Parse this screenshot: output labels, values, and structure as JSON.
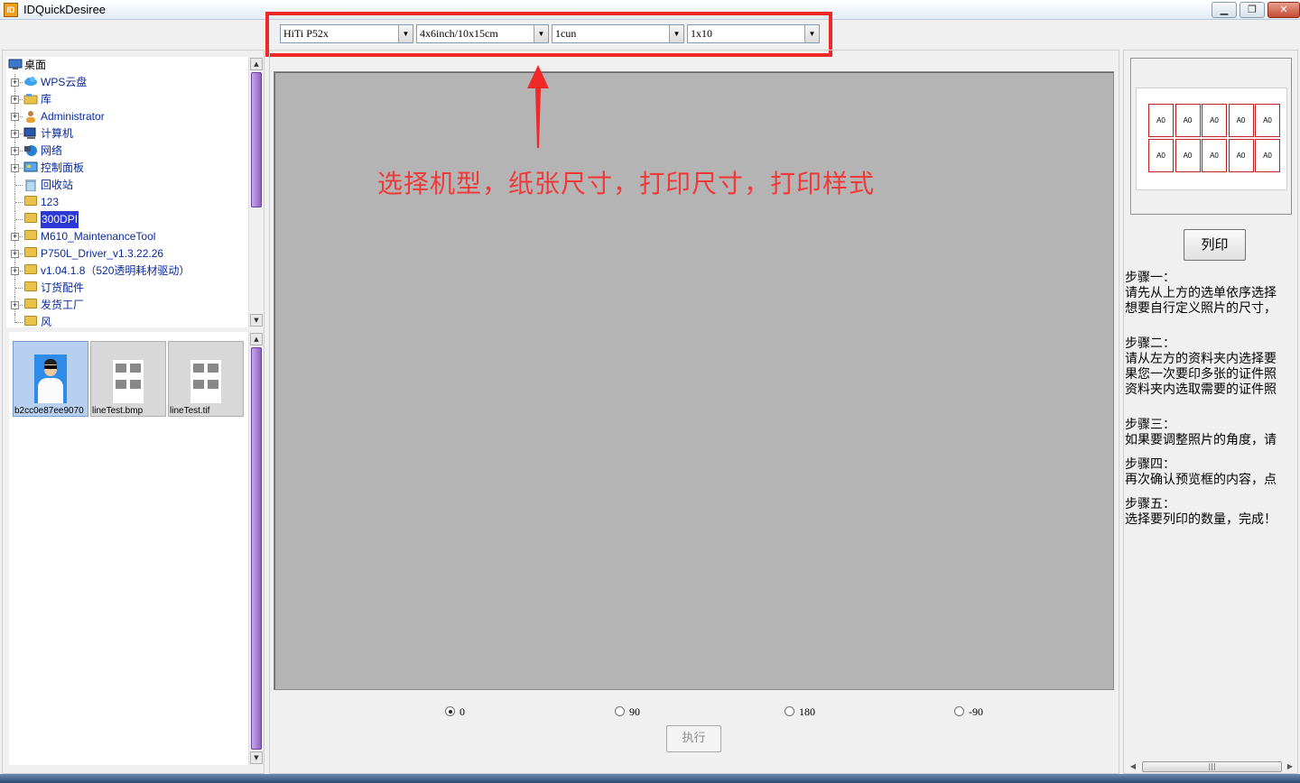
{
  "window": {
    "title": "IDQuickDesiree",
    "icon_text": "ID"
  },
  "toolbar": {
    "printer": "HiTi P52x",
    "paper_size": "4x6inch/10x15cm",
    "print_size": "1cun",
    "print_style": "1x10"
  },
  "annotation": {
    "text": "选择机型，纸张尺寸，打印尺寸，打印样式"
  },
  "tree": {
    "root": "桌面",
    "items": [
      {
        "label": "WPS云盘",
        "expandable": true,
        "icon": "cloud-icon"
      },
      {
        "label": "库",
        "expandable": true,
        "icon": "library-icon"
      },
      {
        "label": "Administrator",
        "expandable": true,
        "icon": "user-icon"
      },
      {
        "label": "计算机",
        "expandable": true,
        "icon": "computer-icon"
      },
      {
        "label": "网络",
        "expandable": true,
        "icon": "network-icon"
      },
      {
        "label": "控制面板",
        "expandable": true,
        "icon": "control-panel-icon"
      },
      {
        "label": "回收站",
        "expandable": false,
        "icon": "recycle-bin-icon"
      },
      {
        "label": "123",
        "expandable": false,
        "icon": "folder-icon"
      },
      {
        "label": "300DPI",
        "expandable": false,
        "icon": "folder-icon",
        "selected": true
      },
      {
        "label": "M610_MaintenanceTool",
        "expandable": true,
        "icon": "folder-icon"
      },
      {
        "label": "P750L_Driver_v1.3.22.26",
        "expandable": true,
        "icon": "folder-icon"
      },
      {
        "label": "v1.04.1.8（520透明耗材驱动）",
        "expandable": true,
        "icon": "folder-icon"
      },
      {
        "label": "订货配件",
        "expandable": false,
        "icon": "folder-icon"
      },
      {
        "label": "发货工厂",
        "expandable": true,
        "icon": "folder-icon"
      },
      {
        "label": "风",
        "expandable": false,
        "icon": "folder-icon"
      }
    ]
  },
  "thumbnails": [
    {
      "caption": "b2cc0e87ee9070",
      "type": "photo",
      "active": true
    },
    {
      "caption": "lineTest.bmp",
      "type": "grid",
      "active": false
    },
    {
      "caption": "lineTest.tif",
      "type": "grid",
      "active": false
    }
  ],
  "rotation": {
    "options": [
      "0",
      "90",
      "180",
      "-90"
    ],
    "selected": "0"
  },
  "execute_label": "执行",
  "layout_preview": {
    "rows": [
      [
        "A0",
        "A0",
        "A0",
        "A0",
        "A0"
      ],
      [
        "A0",
        "A0",
        "A0",
        "A0",
        "A0"
      ]
    ]
  },
  "print_label": "列印",
  "steps": [
    {
      "title": "步骤一：",
      "lines": [
        "请先从上方的选单依序选择",
        "想要自行定义照片的尺寸，"
      ]
    },
    {
      "title": "步骤二：",
      "lines": [
        "请从左方的资料夹内选择要",
        "果您一次要印多张的证件照",
        "资料夹内选取需要的证件照"
      ]
    },
    {
      "title": "步骤三：",
      "lines": [
        "如果要调整照片的角度，请"
      ]
    },
    {
      "title": "步骤四：",
      "lines": [
        "再次确认预览框的内容，点"
      ]
    },
    {
      "title": "步骤五：",
      "lines": [
        "选择要列印的数量，完成！"
      ]
    }
  ],
  "colors": {
    "highlight": "#f02828",
    "annotation": "#f03a3a",
    "selection": "#2b37d6",
    "preview_bg": "#b4b4b4"
  }
}
